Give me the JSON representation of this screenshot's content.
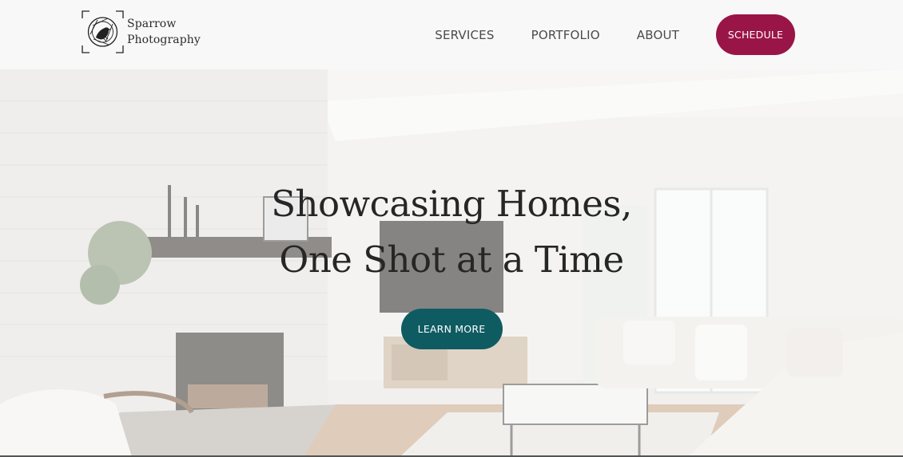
{
  "header": {
    "logo": {
      "line1": "Sparrow",
      "line2": "Photography",
      "icon": "sparrow-camera-logo-icon"
    },
    "nav": [
      {
        "label": "SERVICES"
      },
      {
        "label": "PORTFOLIO"
      },
      {
        "label": "ABOUT"
      }
    ],
    "schedule_label": "SCHEDULE"
  },
  "hero": {
    "title_line1": "Showcasing Homes,",
    "title_line2": "One Shot at a Time",
    "cta_label": "LEARN MORE",
    "background": "living-room-photo"
  },
  "colors": {
    "header_bg": "#f8f8f8",
    "schedule_button": "#9a1547",
    "cta_button": "#0f5b62",
    "text_dark": "#262626",
    "nav_text": "#4a4a4a"
  }
}
